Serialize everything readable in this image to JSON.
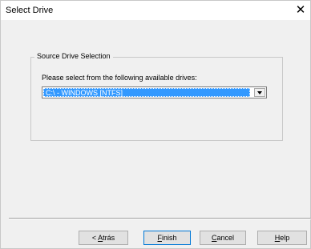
{
  "window": {
    "title": "Select Drive",
    "close_glyph": "✕"
  },
  "group": {
    "legend": "Source Drive Selection",
    "prompt": "Please select from the following available drives:",
    "drive_select": {
      "selected": "C:\\ - WINDOWS [NTFS]"
    }
  },
  "buttons": {
    "back": {
      "prefix": "< ",
      "accel": "A",
      "rest": "trás"
    },
    "finish": {
      "accel": "F",
      "rest": "inish"
    },
    "cancel": {
      "accel": "C",
      "rest": "ancel"
    },
    "help": {
      "accel": "H",
      "rest": "elp"
    }
  }
}
